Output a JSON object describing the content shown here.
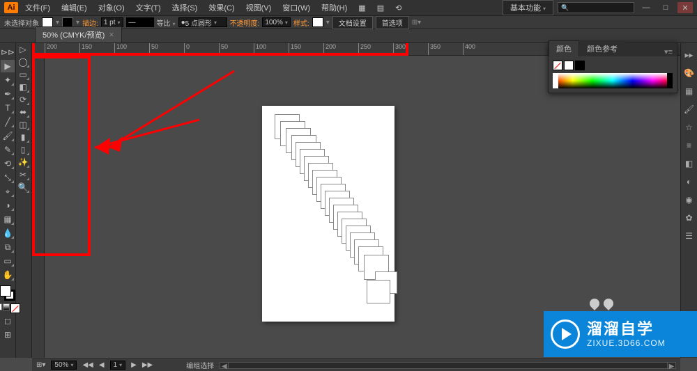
{
  "app": {
    "logo": "Ai"
  },
  "menu": {
    "items": [
      "文件(F)",
      "编辑(E)",
      "对象(O)",
      "文字(T)",
      "选择(S)",
      "效果(C)",
      "视图(V)",
      "窗口(W)",
      "帮助(H)"
    ]
  },
  "workspace": {
    "label": "基本功能"
  },
  "search": {
    "placeholder": ""
  },
  "win": {
    "min": "—",
    "max": "□",
    "close": "✕"
  },
  "control": {
    "noselect": "未选择对象",
    "stroke": "描边:",
    "stroke_val": "1 pt",
    "dash": "等比",
    "brush": "5 点圆形",
    "opacity": "不透明度:",
    "opacity_val": "100%",
    "style": "样式:",
    "docsetup": "文档设置",
    "prefs": "首选项"
  },
  "tab": {
    "title": "50% (CMYK/预览)"
  },
  "ruler": {
    "ticks": [
      "200",
      "150",
      "100",
      "50",
      "0",
      "50",
      "100",
      "150",
      "200",
      "250",
      "300",
      "350",
      "400"
    ]
  },
  "panel": {
    "color": "颜色",
    "guide": "颜色参考"
  },
  "status": {
    "zoom": "50%",
    "page": "1",
    "mode": "编组选择"
  },
  "watermark": {
    "cn": "溜溜自学",
    "url": "ZIXUE.3D66.COM"
  },
  "tooltip": {
    "icons": [
      "▤",
      "▦",
      "⟲"
    ]
  }
}
